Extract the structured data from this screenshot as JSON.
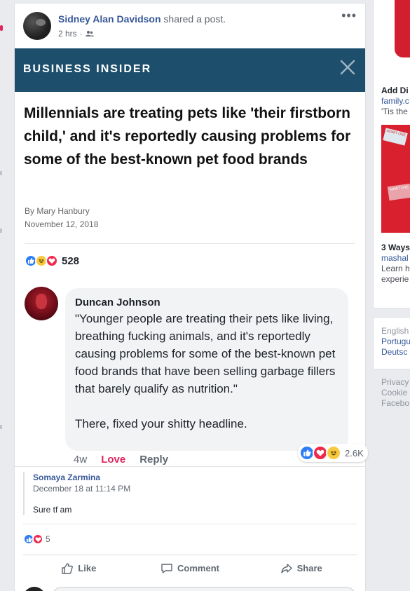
{
  "post": {
    "author": "Sidney Alan Davidson",
    "action": "shared a post.",
    "time": "2 hrs",
    "more": "•••"
  },
  "article": {
    "publisher": "BUSINESS INSIDER",
    "headline": "Millennials are treating pets like 'their firstborn child,' and it's reportedly causing problems for some of the best-known pet food brands",
    "author": "By Mary Hanbury",
    "date": "November 12, 2018"
  },
  "reactions": {
    "count": "528"
  },
  "comment": {
    "author": "Duncan Johnson",
    "line1": "\"Younger people are treating their pets like living, breathing fucking animals, and it's reportedly causing problems for some of the best-known pet food brands that have been selling garbage fillers that barely qualify as nutrition.\"",
    "line2": "There, fixed your shitty headline.",
    "time": "4w",
    "love_label": "Love",
    "reply_label": "Reply",
    "reaction_count": "2.6K"
  },
  "share": {
    "name": "Somaya Zarmina",
    "date": "December 18 at 11:14 PM",
    "text": "Sure tf am",
    "reaction_count": "5"
  },
  "actions": {
    "like": "Like",
    "comment": "Comment",
    "share": "Share"
  },
  "sidebar": {
    "ad1_title": "Add Di",
    "ad1_domain": "family.c",
    "ad1_desc": "'Tis the",
    "ad2_title": "3 Ways",
    "ad2_domain": "mashal",
    "ad2_desc1": "Learn h",
    "ad2_desc2": "experie",
    "lang1": "English",
    "lang2": "Portugu",
    "lang3": "Deutsc",
    "foot1": "Privacy",
    "foot2": "Cookie",
    "foot3": "Facebo",
    "ticket_label": "ADMIT ONE"
  },
  "colors": {
    "fb_blue": "#365899",
    "bi_header": "#1d4f6c",
    "love": "#e0245e",
    "like": "#2e7df6"
  }
}
